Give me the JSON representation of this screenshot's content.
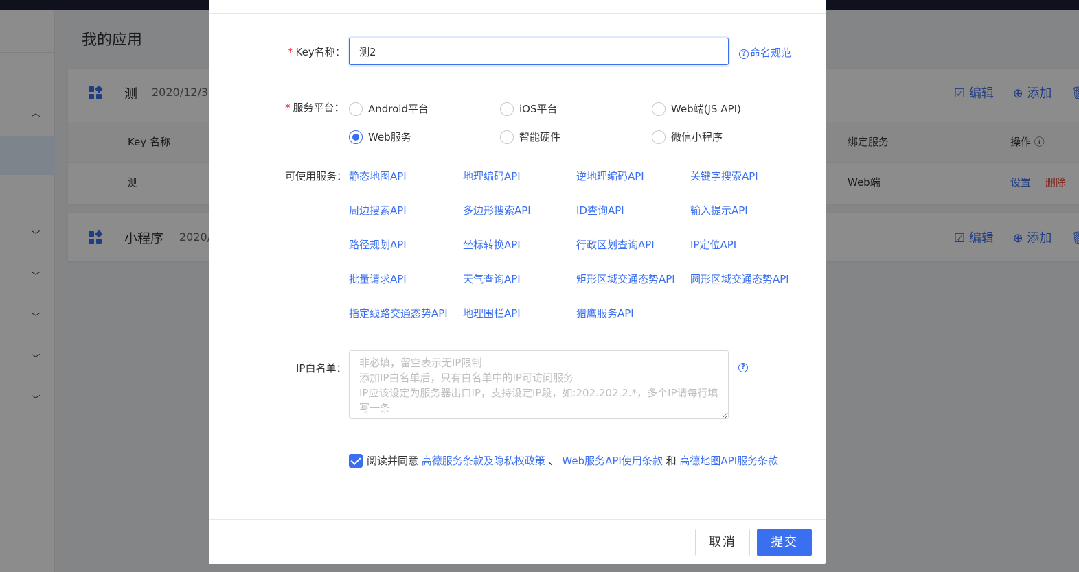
{
  "background": {
    "page_title": "我的应用",
    "apps": [
      {
        "name": "测",
        "date": "2020/12/3",
        "actions": [
          "编辑",
          "添加"
        ]
      },
      {
        "name": "小程序",
        "date": "2020/",
        "actions": [
          "编辑",
          "添加"
        ]
      }
    ],
    "table": {
      "headers": {
        "key_name": "Key 名称",
        "bound_service": "绑定服务",
        "operation": "操作 ⓘ"
      },
      "row": {
        "key_name": "测",
        "bound_service": "Web端",
        "settings": "设置",
        "delete": "删除"
      }
    }
  },
  "modal": {
    "key_name_label": "Key名称：",
    "key_name_value": "测2",
    "naming_rules_link": "命名规范",
    "platform_label": "服务平台：",
    "platforms": [
      {
        "label": "Android平台",
        "checked": false
      },
      {
        "label": "iOS平台",
        "checked": false
      },
      {
        "label": "Web端(JS API)",
        "checked": false
      },
      {
        "label": "Web服务",
        "checked": true
      },
      {
        "label": "智能硬件",
        "checked": false
      },
      {
        "label": "微信小程序",
        "checked": false
      }
    ],
    "services_label": "可使用服务：",
    "services": [
      "静态地图API",
      "地理编码API",
      "逆地理编码API",
      "关键字搜索API",
      "周边搜索API",
      "多边形搜索API",
      "ID查询API",
      "输入提示API",
      "路径规划API",
      "坐标转换API",
      "行政区划查询API",
      "IP定位API",
      "批量请求API",
      "天气查询API",
      "矩形区域交通态势API",
      "圆形区域交通态势API",
      "指定线路交通态势API",
      "地理围栏API",
      "猎鹰服务API"
    ],
    "ip_label": "IP白名单：",
    "ip_placeholder": "非必填，留空表示无IP限制\n添加IP白名单后，只有白名单中的IP可访问服务\nIP应该设定为服务器出口IP，支持设定IP段，如:202.202.2.*，多个IP请每行填写一条",
    "agree": {
      "checked": true,
      "prefix": "阅读并同意",
      "link1": "高德服务条款及隐私权政策",
      "sep1": "、",
      "link2": "Web服务API使用条款",
      "sep2": "和",
      "link3": "高德地图API服务条款"
    },
    "cancel_button": "取消",
    "submit_button": "提交"
  },
  "colors": {
    "accent": "#3a6ff0",
    "danger": "#e84c3d",
    "required": "#f5222d"
  }
}
